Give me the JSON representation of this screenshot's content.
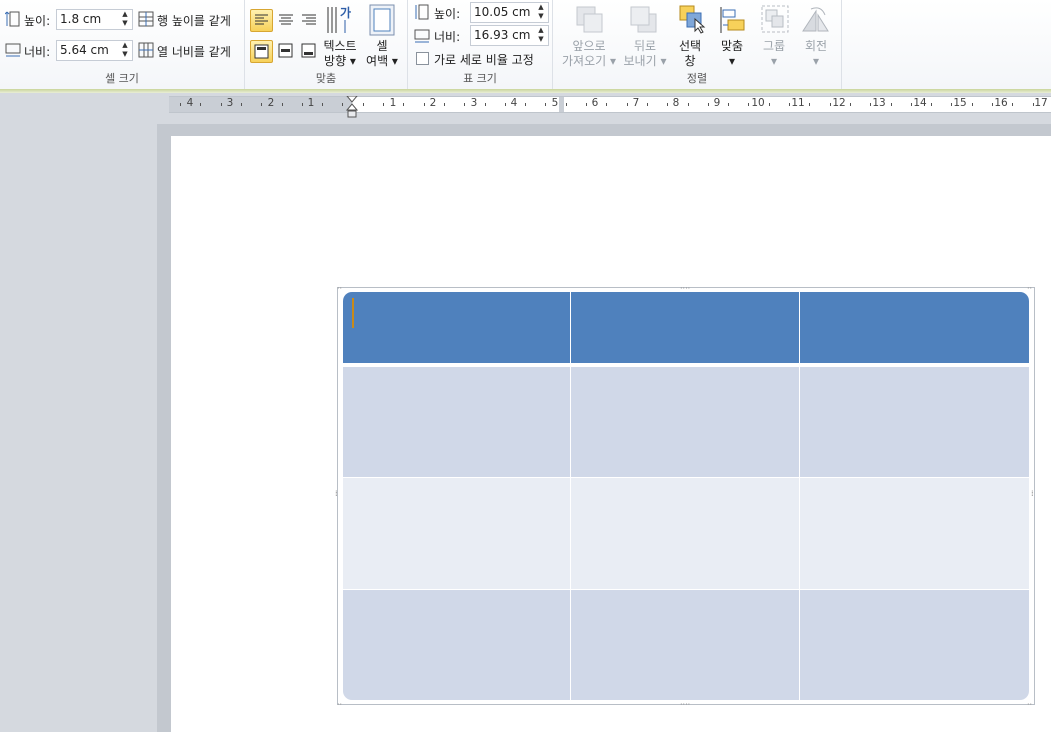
{
  "cell_size": {
    "group_label": "셀 크기",
    "height_label": "높이:",
    "height_value": "1.8 cm",
    "width_label": "너비:",
    "width_value": "5.64 cm",
    "distribute_rows": "행 높이를 같게",
    "distribute_cols": "열 너비를 같게"
  },
  "alignment": {
    "group_label": "맞춤",
    "text_direction_line1": "텍스트",
    "text_direction_line2": "방향 ▾",
    "text_dir_glyph": "가",
    "cell_margins_line1": "셀",
    "cell_margins_line2": "여백 ▾"
  },
  "table_size": {
    "group_label": "표 크기",
    "height_label": "높이:",
    "height_value": "10.05 cm",
    "width_label": "너비:",
    "width_value": "16.93 cm",
    "lock_aspect_label": "가로 세로 비율 고정"
  },
  "arrange": {
    "group_label": "정렬",
    "bring_forward_line1": "앞으로",
    "bring_forward_line2": "가져오기 ▾",
    "send_backward_line1": "뒤로",
    "send_backward_line2": "보내기 ▾",
    "selection_pane_line1": "선택",
    "selection_pane_line2": "창",
    "align_line1": "맞춤",
    "align_line2": "▾",
    "group_line1": "그룹",
    "group_line2": "▾",
    "rotate_line1": "회전",
    "rotate_line2": "▾"
  },
  "ruler": {
    "left_numbers": [
      "4",
      "3",
      "2",
      "1"
    ],
    "right_numbers": [
      "1",
      "2",
      "3",
      "4",
      "5",
      "6",
      "7",
      "8",
      "9",
      "10",
      "11",
      "12",
      "13",
      "14",
      "15",
      "16",
      "17"
    ]
  },
  "colors": {
    "header": "#4f81bd",
    "band_dark": "#d0d8e8",
    "band_light": "#e9edf4",
    "accent": "#f7d15a"
  }
}
